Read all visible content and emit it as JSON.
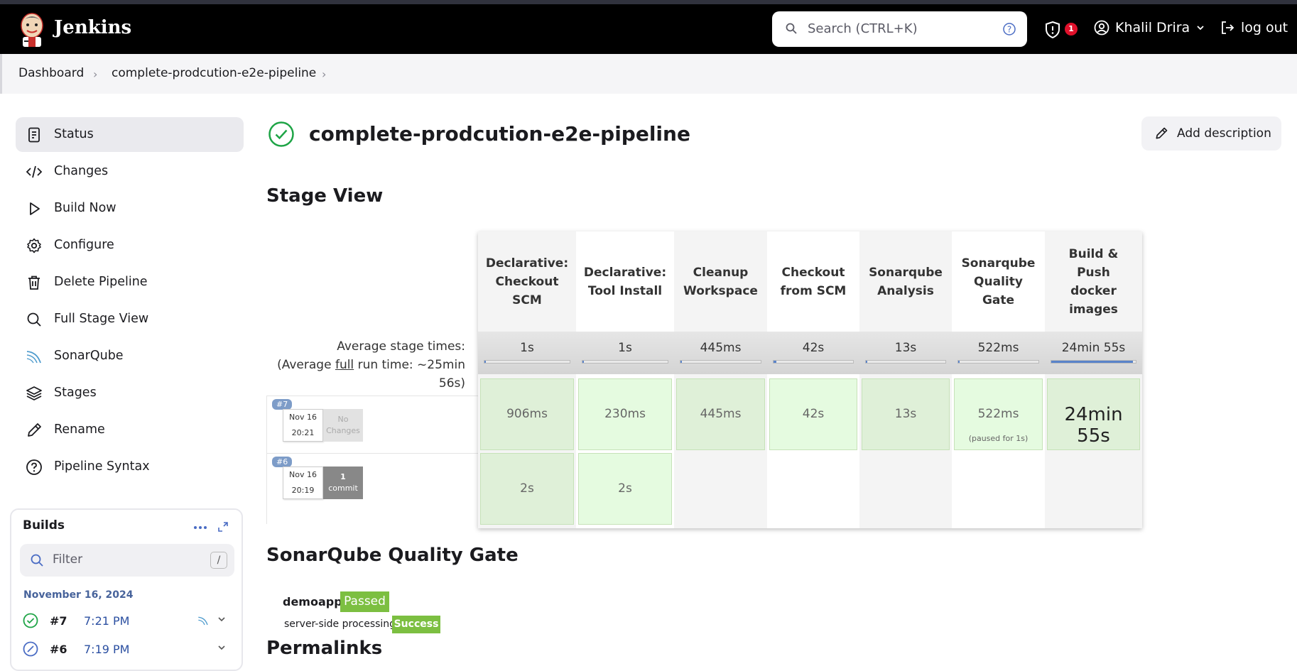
{
  "header": {
    "brand": "Jenkins",
    "search_placeholder": "Search (CTRL+K)",
    "security_badge_count": "1",
    "user_name": "Khalil Drira",
    "logout_label": "log out"
  },
  "breadcrumb": {
    "items": [
      "Dashboard",
      "complete-prodcution-e2e-pipeline"
    ]
  },
  "sidebar": {
    "items": [
      {
        "label": "Status",
        "icon": "document-icon"
      },
      {
        "label": "Changes",
        "icon": "code-icon"
      },
      {
        "label": "Build Now",
        "icon": "play-icon"
      },
      {
        "label": "Configure",
        "icon": "gear-icon"
      },
      {
        "label": "Delete Pipeline",
        "icon": "trash-icon"
      },
      {
        "label": "Full Stage View",
        "icon": "search-icon"
      },
      {
        "label": "SonarQube",
        "icon": "sonarqube-icon"
      },
      {
        "label": "Stages",
        "icon": "layers-icon"
      },
      {
        "label": "Rename",
        "icon": "pencil-icon"
      },
      {
        "label": "Pipeline Syntax",
        "icon": "help-icon"
      }
    ]
  },
  "builds": {
    "title": "Builds",
    "filter_placeholder": "Filter",
    "filter_shortcut": "/",
    "date_group": "November 16, 2024",
    "items": [
      {
        "number": "#7",
        "time": "7:21 PM",
        "status": "success"
      },
      {
        "number": "#6",
        "time": "7:19 PM",
        "status": "aborted"
      }
    ]
  },
  "main": {
    "title": "complete-prodcution-e2e-pipeline",
    "add_description": "Add description",
    "stage_view_heading": "Stage View",
    "quality_gate_heading": "SonarQube Quality Gate",
    "permalinks_heading": "Permalinks"
  },
  "stage_view": {
    "avg_label_line1": "Average stage times:",
    "avg_label_line2_pre": "(Average ",
    "avg_label_line2_link": "full",
    "avg_label_line2_post": " run time: ~25min",
    "avg_label_line3": "56s)",
    "stages": [
      {
        "name_lines": [
          "Declarative:",
          "Checkout",
          "SCM"
        ],
        "avg": "1s",
        "avg_fraction": 0.02
      },
      {
        "name_lines": [
          "Declarative:",
          "Tool Install"
        ],
        "avg": "1s",
        "avg_fraction": 0.02
      },
      {
        "name_lines": [
          "Cleanup",
          "Workspace"
        ],
        "avg": "445ms",
        "avg_fraction": 0.01
      },
      {
        "name_lines": [
          "Checkout",
          "from SCM"
        ],
        "avg": "42s",
        "avg_fraction": 0.04
      },
      {
        "name_lines": [
          "Sonarqube",
          "Analysis"
        ],
        "avg": "13s",
        "avg_fraction": 0.02
      },
      {
        "name_lines": [
          "Sonarqube",
          "Quality",
          "Gate"
        ],
        "avg": "522ms",
        "avg_fraction": 0.01
      },
      {
        "name_lines": [
          "Build &",
          "Push",
          "docker",
          "images"
        ],
        "avg": "24min 55s",
        "avg_fraction": 0.97
      }
    ],
    "runs": [
      {
        "tag": "#7",
        "date": "Nov 16",
        "time": "20:21",
        "changes_line1": "No",
        "changes_line2": "Changes",
        "has_commits": false,
        "cells": [
          {
            "value": "906ms",
            "sub": "",
            "big": false
          },
          {
            "value": "230ms",
            "sub": "",
            "big": false
          },
          {
            "value": "445ms",
            "sub": "",
            "big": false
          },
          {
            "value": "42s",
            "sub": "",
            "big": false
          },
          {
            "value": "13s",
            "sub": "",
            "big": false
          },
          {
            "value": "522ms",
            "sub": "(paused for 1s)",
            "big": false
          },
          {
            "value": "24min 55s",
            "sub": "",
            "big": true
          }
        ]
      },
      {
        "tag": "#6",
        "date": "Nov 16",
        "time": "20:19",
        "changes_line1": "1",
        "changes_line2": "commit",
        "has_commits": true,
        "cells": [
          {
            "value": "2s",
            "sub": "",
            "big": false
          },
          {
            "value": "2s",
            "sub": "",
            "big": false
          },
          null,
          null,
          null,
          null,
          null
        ]
      }
    ]
  },
  "quality_gate": {
    "project": "demoapp",
    "status": "Passed",
    "processing_label": "server-side processing:",
    "processing_status": "Success"
  },
  "colors": {
    "success_green": "#7cbf41",
    "cell_green": "#dff0d8",
    "link_blue": "#2b4fa1"
  }
}
